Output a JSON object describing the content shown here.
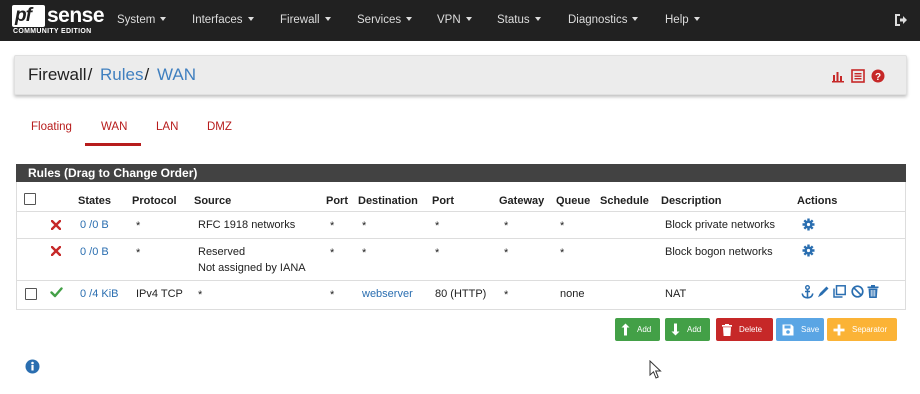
{
  "brand": {
    "logo_box_text": "pf",
    "logo_text": "sense",
    "logo_sub": "COMMUNITY EDITION"
  },
  "nav": {
    "items": [
      "System",
      "Interfaces",
      "Firewall",
      "Services",
      "VPN",
      "Status",
      "Diagnostics",
      "Help"
    ]
  },
  "breadcrumb": {
    "part1": "Firewall",
    "separator": "/",
    "part2": "Rules",
    "part3": "WAN"
  },
  "tabs": [
    "Floating",
    "WAN",
    "LAN",
    "DMZ"
  ],
  "active_tab": "WAN",
  "panel_title": "Rules (Drag to Change Order)",
  "table": {
    "columns": [
      "States",
      "Protocol",
      "Source",
      "Port",
      "Destination",
      "Port",
      "Gateway",
      "Queue",
      "Schedule",
      "Description",
      "Actions"
    ],
    "rows": [
      {
        "status": "block",
        "states": "0 /0 B",
        "protocol": "*",
        "source": "RFC 1918 networks",
        "source_line2": "",
        "port": "*",
        "destination": "*",
        "dest_port": "*",
        "gateway": "*",
        "queue": "*",
        "schedule": "",
        "description": "Block private networks"
      },
      {
        "status": "block",
        "states": "0 /0 B",
        "protocol": "*",
        "source": "Reserved",
        "source_line2": "Not assigned by IANA",
        "port": "*",
        "destination": "*",
        "dest_port": "*",
        "gateway": "*",
        "queue": "*",
        "schedule": "",
        "description": "Block bogon networks"
      },
      {
        "status": "pass",
        "states": "0 /4 KiB",
        "protocol": "IPv4 TCP",
        "source": "*",
        "source_line2": "",
        "port": "*",
        "destination": "webserver",
        "dest_port": "80 (HTTP)",
        "gateway": "*",
        "queue": "none",
        "schedule": "",
        "description": "NAT"
      }
    ]
  },
  "buttons": {
    "add_top": "Add",
    "add_bottom": "Add",
    "delete": "Delete",
    "save": "Save",
    "separator": "Separator"
  },
  "colors": {
    "navbar": "#212121",
    "link": "#3f7fbf",
    "tab": "#b71c1c",
    "green": "#43a047",
    "red": "#c62828",
    "blue": "#5aa5e4",
    "orange": "#fbb336"
  }
}
